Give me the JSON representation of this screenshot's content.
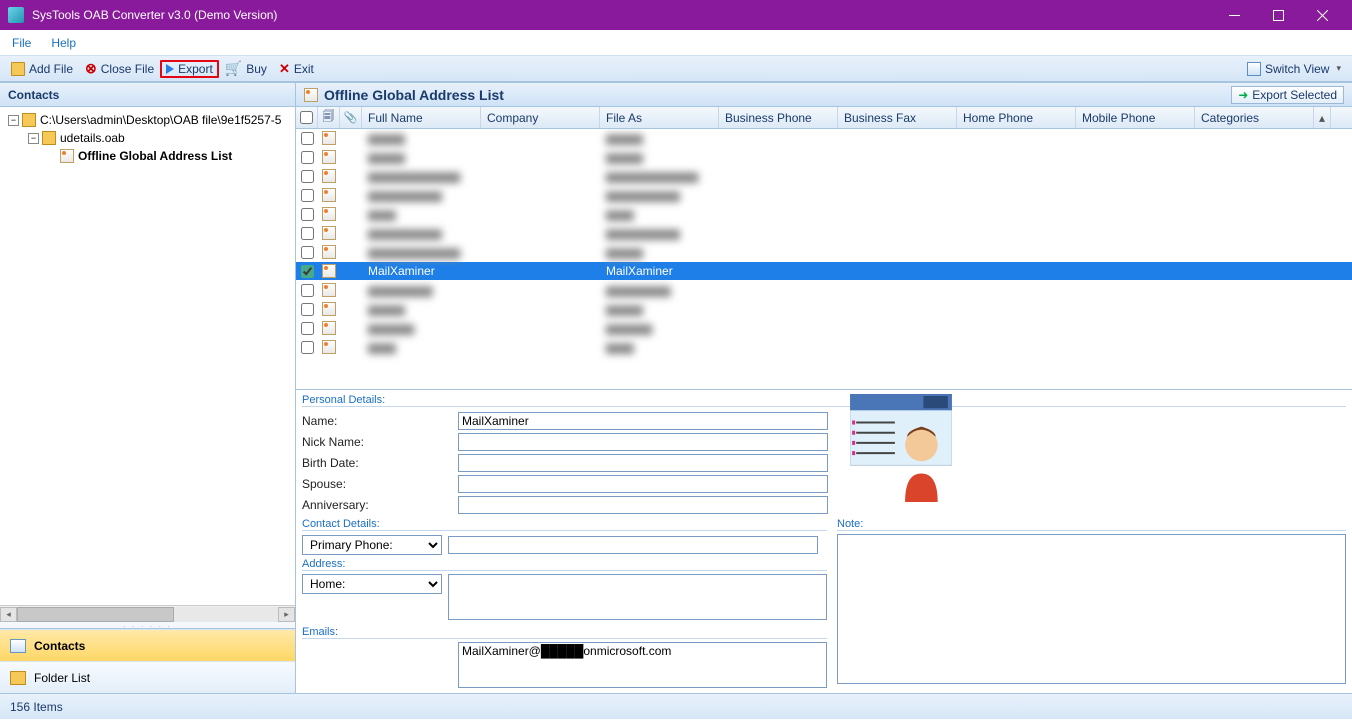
{
  "window": {
    "title": "SysTools OAB Converter v3.0 (Demo Version)"
  },
  "menubar": {
    "file": "File",
    "help": "Help"
  },
  "toolbar": {
    "add_file": "Add File",
    "close_file": "Close File",
    "export": "Export",
    "buy": "Buy",
    "exit": "Exit",
    "switch_view": "Switch View"
  },
  "left": {
    "contacts_title": "Contacts",
    "tree": {
      "root": "C:\\Users\\admin\\Desktop\\OAB file\\9e1f5257-5",
      "file": "udetails.oab",
      "list": "Offline Global Address List"
    },
    "nav": {
      "contacts": "Contacts",
      "folder_list": "Folder List"
    }
  },
  "grid": {
    "title": "Offline Global Address List",
    "export_selected": "Export Selected",
    "columns": [
      "Full Name",
      "Company",
      "File As",
      "Business Phone",
      "Business Fax",
      "Home Phone",
      "Mobile Phone",
      "Categories"
    ],
    "rows": [
      {
        "full": "████",
        "fileas": "████",
        "blurred": true
      },
      {
        "full": "████",
        "fileas": "████",
        "blurred": true
      },
      {
        "full": "██████████",
        "fileas": "██████████",
        "blurred": true
      },
      {
        "full": "████████",
        "fileas": "████████",
        "blurred": true
      },
      {
        "full": "███",
        "fileas": "███",
        "blurred": true
      },
      {
        "full": "████████",
        "fileas": "████████",
        "blurred": true
      },
      {
        "full": "██████████",
        "fileas": "████",
        "blurred": true
      },
      {
        "full": "MailXaminer",
        "fileas": "MailXaminer",
        "selected": true
      },
      {
        "full": "███████",
        "fileas": "███████",
        "blurred": true
      },
      {
        "full": "████",
        "fileas": "████",
        "blurred": true
      },
      {
        "full": "█████",
        "fileas": "█████",
        "blurred": true
      },
      {
        "full": "███",
        "fileas": "███",
        "blurred": true
      }
    ]
  },
  "details": {
    "personal": {
      "legend": "Personal Details:",
      "name_lbl": "Name:",
      "name_val": "MailXaminer",
      "nick_lbl": "Nick Name:",
      "nick_val": "",
      "birth_lbl": "Birth Date:",
      "birth_val": "",
      "spouse_lbl": "Spouse:",
      "spouse_val": "",
      "anniv_lbl": "Anniversary:",
      "anniv_val": ""
    },
    "contact": {
      "legend": "Contact Details:",
      "phone_sel": "Primary Phone:",
      "phone_val": ""
    },
    "address": {
      "legend": "Address:",
      "addr_sel": "Home:",
      "addr_val": ""
    },
    "emails": {
      "legend": "Emails:",
      "email_val": "MailXaminer@█████onmicrosoft.com"
    },
    "note": {
      "legend": "Note:",
      "note_val": ""
    }
  },
  "status": {
    "items": "156 Items"
  }
}
